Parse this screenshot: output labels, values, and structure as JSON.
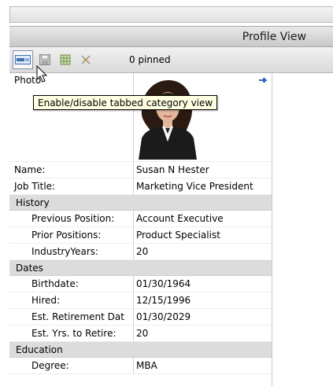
{
  "header": {
    "title": "Profile View"
  },
  "toolbar": {
    "pinned_text": "0 pinned",
    "buttons": [
      {
        "icon": "tabbed-category-icon",
        "active": true
      },
      {
        "icon": "save-icon"
      },
      {
        "icon": "grid-icon"
      },
      {
        "icon": "clear-icon"
      }
    ]
  },
  "tooltip": {
    "text": "Enable/disable tabbed category view"
  },
  "profile": {
    "photo_label": "Photo",
    "name_label": "Name:",
    "name_value": "Susan N Hester",
    "job_label": "Job Title:",
    "job_value": "Marketing Vice President"
  },
  "history": {
    "title": "History",
    "prev_label": "Previous Position:",
    "prev_value": "Account Executive",
    "prior_label": "Prior Positions:",
    "prior_value": "Product Specialist",
    "industry_label": "IndustryYears:",
    "industry_value": "20"
  },
  "dates": {
    "title": "Dates",
    "birth_label": "Birthdate:",
    "birth_value": "01/30/1964",
    "hired_label": "Hired:",
    "hired_value": "12/15/1996",
    "retire_label": "Est. Retirement Dat",
    "retire_value": "01/30/2029",
    "yrs_label": "Est. Yrs. to Retire:",
    "yrs_value": "20"
  },
  "education": {
    "title": "Education",
    "degree_label": "Degree:",
    "degree_value": "MBA"
  }
}
